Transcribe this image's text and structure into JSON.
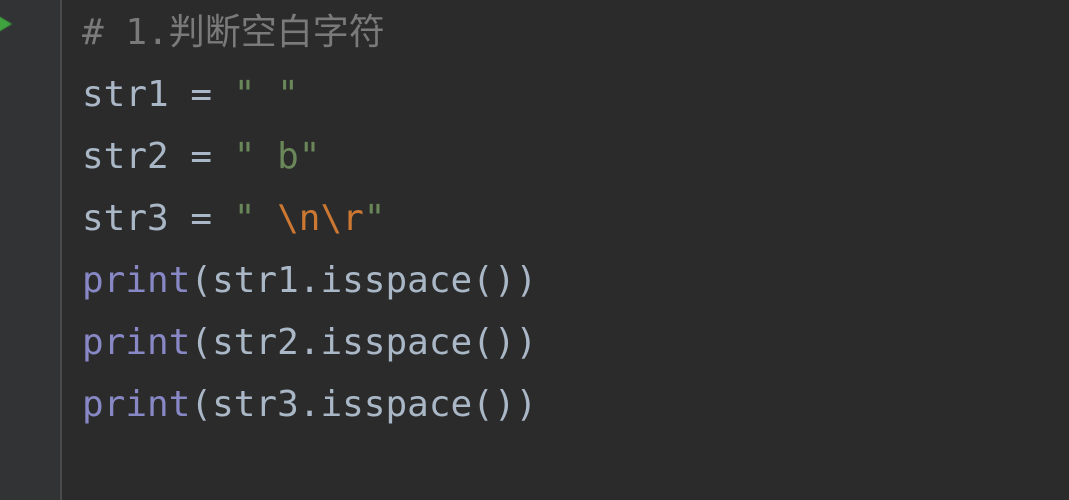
{
  "code": {
    "lines": [
      {
        "type": "comment",
        "raw": "# 1.判断空白字符",
        "tokens": [
          {
            "cls": "comment",
            "text": "# 1.判断空白字符"
          }
        ]
      },
      {
        "type": "assign",
        "tokens": [
          {
            "cls": "ident",
            "text": "str1 "
          },
          {
            "cls": "op",
            "text": "= "
          },
          {
            "cls": "string",
            "text": "\" \""
          }
        ]
      },
      {
        "type": "assign",
        "tokens": [
          {
            "cls": "ident",
            "text": "str2 "
          },
          {
            "cls": "op",
            "text": "= "
          },
          {
            "cls": "string",
            "text": "\" b\""
          }
        ]
      },
      {
        "type": "assign",
        "tokens": [
          {
            "cls": "ident",
            "text": "str3 "
          },
          {
            "cls": "op",
            "text": "= "
          },
          {
            "cls": "string",
            "text": "\" "
          },
          {
            "cls": "escape",
            "text": "\\n\\r"
          },
          {
            "cls": "string",
            "text": "\""
          }
        ]
      },
      {
        "type": "call",
        "tokens": [
          {
            "cls": "builtin",
            "text": "print"
          },
          {
            "cls": "paren",
            "text": "("
          },
          {
            "cls": "ident",
            "text": "str1"
          },
          {
            "cls": "op",
            "text": "."
          },
          {
            "cls": "ident",
            "text": "isspace"
          },
          {
            "cls": "paren",
            "text": "())"
          }
        ]
      },
      {
        "type": "call",
        "tokens": [
          {
            "cls": "builtin",
            "text": "print"
          },
          {
            "cls": "paren",
            "text": "("
          },
          {
            "cls": "ident",
            "text": "str2"
          },
          {
            "cls": "op",
            "text": "."
          },
          {
            "cls": "ident",
            "text": "isspace"
          },
          {
            "cls": "paren",
            "text": "())"
          }
        ]
      },
      {
        "type": "call",
        "tokens": [
          {
            "cls": "builtin",
            "text": "print"
          },
          {
            "cls": "paren",
            "text": "("
          },
          {
            "cls": "ident",
            "text": "str3"
          },
          {
            "cls": "op",
            "text": "."
          },
          {
            "cls": "ident",
            "text": "isspace"
          },
          {
            "cls": "paren",
            "text": "())"
          }
        ]
      }
    ]
  },
  "colors": {
    "background": "#2b2b2b",
    "gutter": "#313335",
    "default_fg": "#a9b7c6",
    "comment": "#7a7a7a",
    "string": "#6a8759",
    "escape": "#cc7832",
    "builtin": "#8888c6",
    "run_marker": "#3fa33f"
  }
}
